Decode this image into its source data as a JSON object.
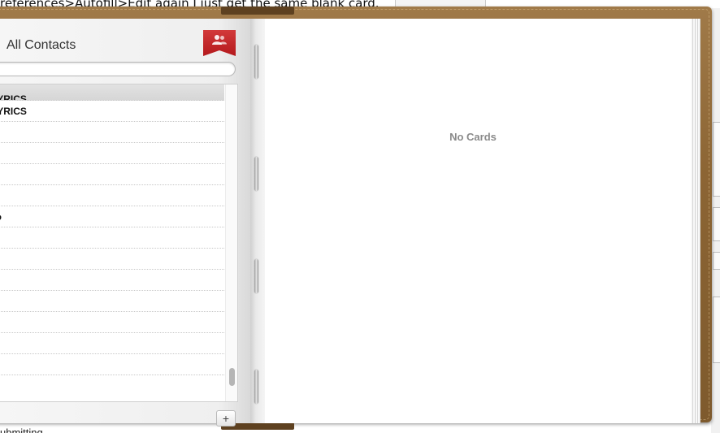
{
  "background_window": {
    "top_text": "references>Autofill>Edit again I just get the same blank card.",
    "bottom_text": "ubmitting"
  },
  "address_book": {
    "group_title": "All Contacts",
    "bookmark_icon": "people-icon",
    "search": {
      "value": "",
      "placeholder": ""
    },
    "contacts": [
      "LYRICS",
      "LYRICS",
      "",
      "",
      "",
      "",
      "ro",
      "",
      "",
      "",
      "",
      "",
      "",
      ""
    ],
    "add_button_label": "+",
    "card_area": {
      "message": "No Cards"
    }
  },
  "colors": {
    "leather": "#8c6534",
    "bookmark_red": "#c1252a",
    "placeholder_text": "#8a8a8a"
  }
}
